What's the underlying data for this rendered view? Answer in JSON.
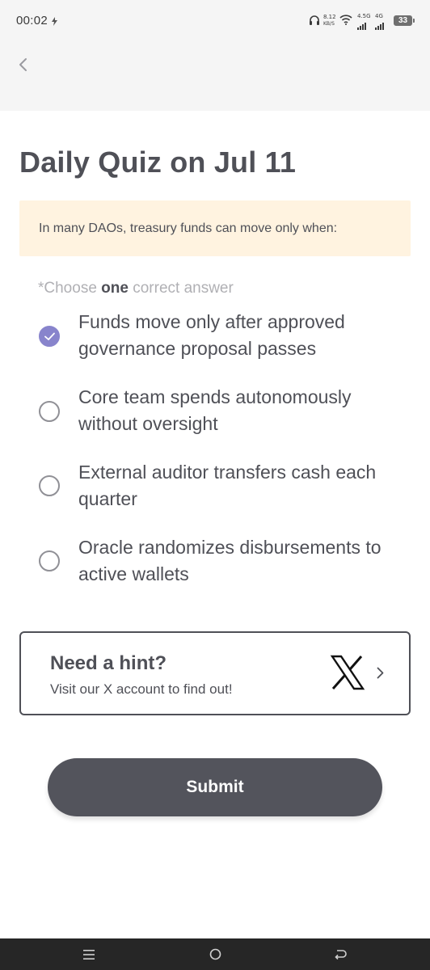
{
  "status_bar": {
    "time": "00:02",
    "net_speed_value": "8.12",
    "net_speed_unit": "KB/S",
    "signal1_label": "4.5G",
    "signal2_label": "4G",
    "battery_level": "33"
  },
  "header": {
    "title": "Daily Quiz on Jul 11"
  },
  "question": {
    "text": "In many DAOs, treasury funds can move only when:"
  },
  "instruction": {
    "prefix": "*Choose ",
    "emphasis": "one",
    "suffix": " correct answer"
  },
  "options": [
    {
      "label": "Funds move only after approved governance proposal passes",
      "selected": true
    },
    {
      "label": "Core team spends autonomously without oversight",
      "selected": false
    },
    {
      "label": "External auditor transfers cash each quarter",
      "selected": false
    },
    {
      "label": "Oracle randomizes disbursements to active wallets",
      "selected": false
    }
  ],
  "hint": {
    "title": "Need a hint?",
    "subtitle": "Visit our X account to find out!"
  },
  "submit": {
    "label": "Submit"
  },
  "colors": {
    "accent": "#8884cc",
    "question_bg": "#fff3e0",
    "button_bg": "#53545c",
    "text": "#4f5057"
  }
}
